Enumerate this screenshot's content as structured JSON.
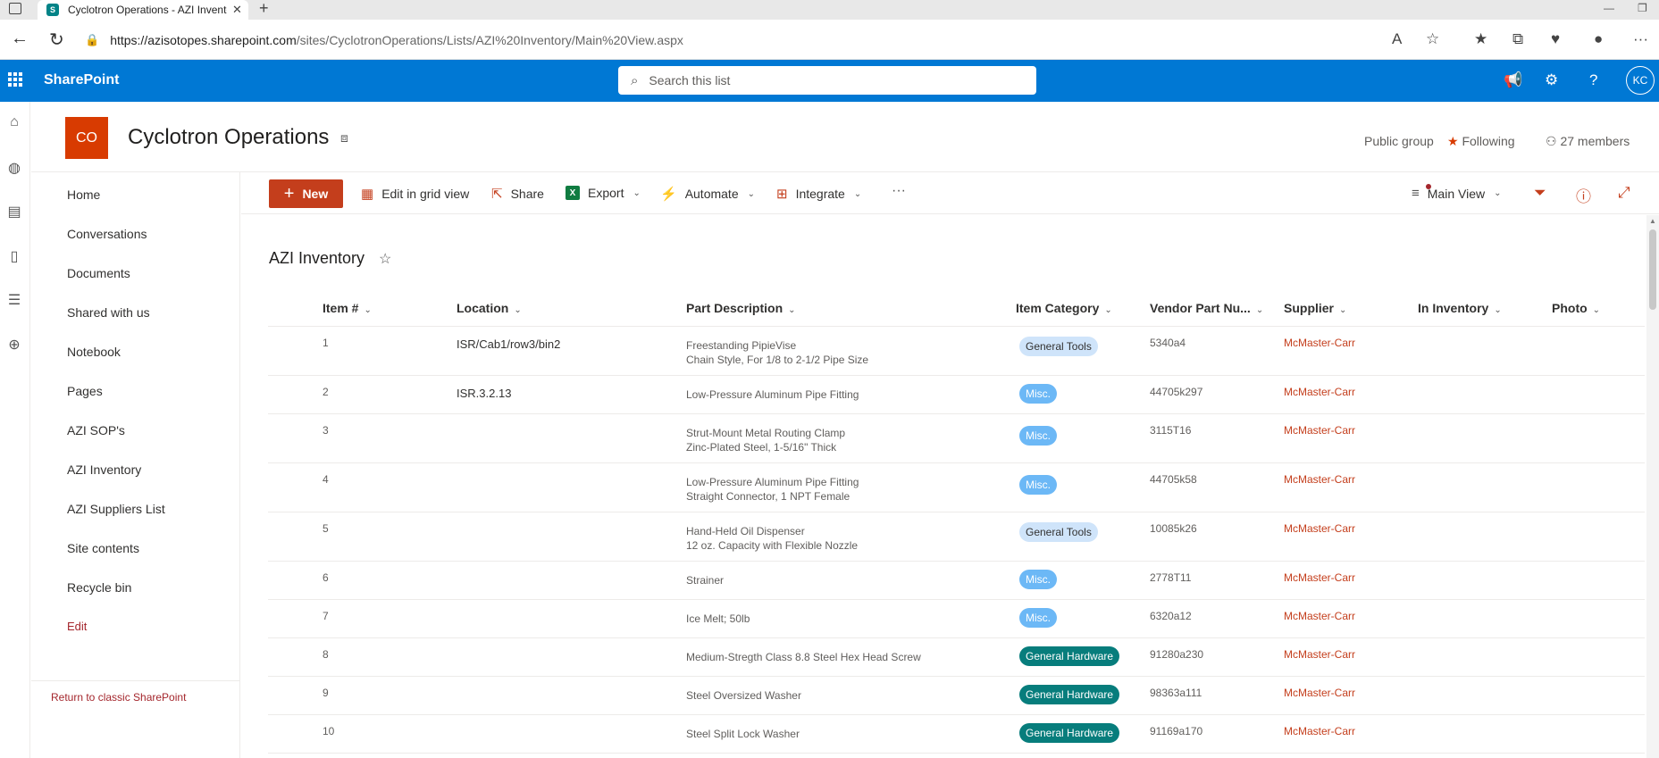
{
  "browser": {
    "tab_title": "Cyclotron Operations - AZI Inventory",
    "tab_favicon": "S",
    "url_host": "https://azisotopes.sharepoint.com",
    "url_path": "/sites/CyclotronOperations/Lists/AZI%20Inventory/Main%20View.aspx"
  },
  "suite": {
    "brand": "SharePoint",
    "search_placeholder": "Search this list",
    "avatar_initials": "KC"
  },
  "site": {
    "logo_initials": "CO",
    "title": "Cyclotron Operations",
    "visibility": "Public group",
    "following": "Following",
    "members": "27 members"
  },
  "nav": {
    "items": [
      "Home",
      "Conversations",
      "Documents",
      "Shared with us",
      "Notebook",
      "Pages",
      "AZI SOP's",
      "AZI Inventory",
      "AZI Suppliers List",
      "Site contents",
      "Recycle bin"
    ],
    "edit": "Edit",
    "classic": "Return to classic SharePoint"
  },
  "commands": {
    "new": "New",
    "grid": "Edit in grid view",
    "share": "Share",
    "export": "Export",
    "automate": "Automate",
    "integrate": "Integrate",
    "more": "···",
    "view": "Main View"
  },
  "list": {
    "title": "AZI Inventory",
    "columns": [
      "Item #",
      "Location",
      "Part Description",
      "Item Category",
      "Vendor Part Nu...",
      "Supplier",
      "In Inventory",
      "Photo"
    ],
    "rows": [
      {
        "num": "1",
        "loc": "ISR/Cab1/row3/bin2",
        "d1": "Freestanding PipieVise",
        "d2": "Chain Style, For 1/8 to 2-1/2 Pipe Size",
        "cat": "General Tools",
        "vpn": "5340a4",
        "sup": "McMaster-Carr"
      },
      {
        "num": "2",
        "loc": "ISR.3.2.13",
        "d1": "Low-Pressure Aluminum Pipe Fitting",
        "d2": "",
        "cat": "Misc.",
        "vpn": "44705k297",
        "sup": "McMaster-Carr"
      },
      {
        "num": "3",
        "loc": "",
        "d1": "Strut-Mount Metal Routing Clamp",
        "d2": "Zinc-Plated Steel, 1-5/16\" Thick",
        "cat": "Misc.",
        "vpn": "3115T16",
        "sup": "McMaster-Carr"
      },
      {
        "num": "4",
        "loc": "",
        "d1": "Low-Pressure Aluminum Pipe Fitting",
        "d2": "Straight Connector, 1 NPT Female",
        "cat": "Misc.",
        "vpn": "44705k58",
        "sup": "McMaster-Carr"
      },
      {
        "num": "5",
        "loc": "",
        "d1": "Hand-Held Oil Dispenser",
        "d2": "12 oz. Capacity with Flexible Nozzle",
        "cat": "General Tools",
        "vpn": "10085k26",
        "sup": "McMaster-Carr"
      },
      {
        "num": "6",
        "loc": "",
        "d1": "Strainer",
        "d2": "",
        "cat": "Misc.",
        "vpn": "2778T11",
        "sup": "McMaster-Carr"
      },
      {
        "num": "7",
        "loc": "",
        "d1": "Ice Melt; 50lb",
        "d2": "",
        "cat": "Misc.",
        "vpn": "6320a12",
        "sup": "McMaster-Carr"
      },
      {
        "num": "8",
        "loc": "",
        "d1": "Medium-Stregth Class 8.8 Steel Hex Head Screw",
        "d2": "",
        "cat": "General Hardware",
        "vpn": "91280a230",
        "sup": "McMaster-Carr"
      },
      {
        "num": "9",
        "loc": "",
        "d1": "Steel Oversized Washer",
        "d2": "",
        "cat": "General Hardware",
        "vpn": "98363a111",
        "sup": "McMaster-Carr"
      },
      {
        "num": "10",
        "loc": "",
        "d1": "Steel Split Lock Washer",
        "d2": "",
        "cat": "General Hardware",
        "vpn": "91169a170",
        "sup": "McMaster-Carr"
      }
    ]
  }
}
